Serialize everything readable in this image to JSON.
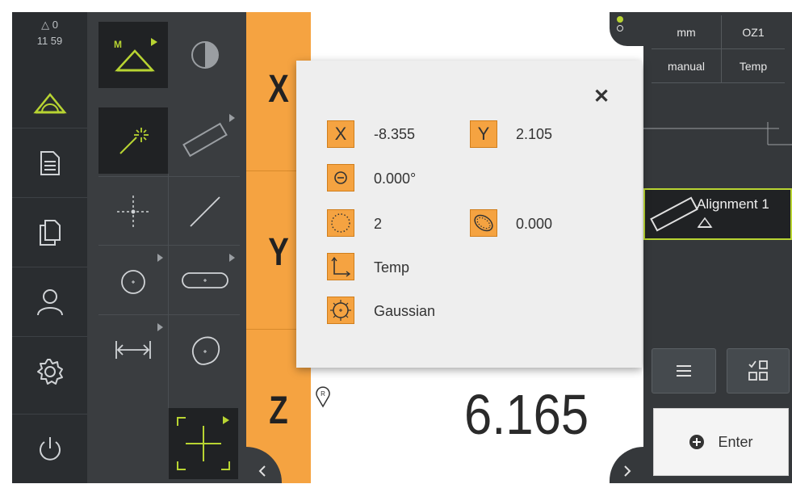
{
  "status": {
    "warning_count": "0",
    "time": "11 59"
  },
  "axes": {
    "x_label": "X",
    "y_label": "Y",
    "z_label": "Z"
  },
  "readout": {
    "z_value": "6.165"
  },
  "units": {
    "unit": "mm",
    "coord_system": "OZ1",
    "mode": "manual",
    "ref": "Temp"
  },
  "feature": {
    "name": "Alignment 1"
  },
  "popup": {
    "x_icon": "X",
    "x_value": "-8.355",
    "y_icon": "Y",
    "y_value": "2.105",
    "angle_value": "0.000°",
    "points_value": "2",
    "form_value": "0.000",
    "reference_value": "Temp",
    "fit_value": "Gaussian",
    "close_symbol": "✕"
  },
  "buttons": {
    "enter_label": "Enter"
  },
  "colors": {
    "accent_orange": "#f5a341",
    "accent_green": "#b8d432",
    "sidebar": "#2a2d30",
    "palette": "#3a3d40",
    "panel": "#35383b"
  },
  "icons": [
    "warning-triangle-icon",
    "measure-icon",
    "document-icon",
    "copy-icon",
    "user-icon",
    "gear-icon",
    "power-icon",
    "auto-measure-icon",
    "contrast-icon",
    "wand-icon",
    "alignment-icon",
    "point-icon",
    "line-icon",
    "circle-icon",
    "slot-icon",
    "distance-icon",
    "blob-icon",
    "crosshair-icon",
    "chevron-left-icon",
    "chevron-right-icon",
    "reference-pin-icon",
    "list-icon",
    "checklist-icon",
    "plus-circle-icon",
    "close-icon"
  ]
}
